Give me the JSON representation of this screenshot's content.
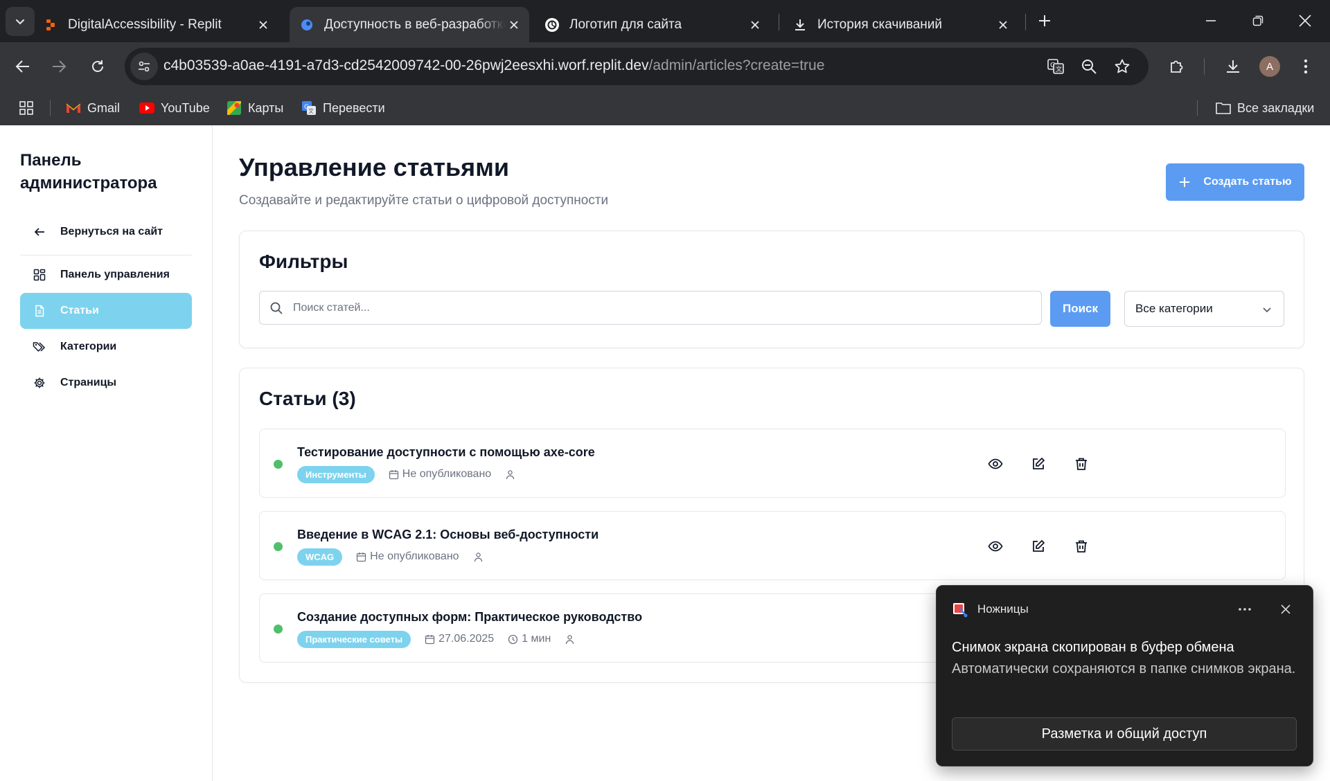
{
  "browser": {
    "tabs": [
      {
        "title": "DigitalAccessibility - Replit",
        "icon": "replit-icon",
        "active": false
      },
      {
        "title": "Доступность в веб-разработке",
        "icon": "replit-favicon-icon",
        "active": true
      },
      {
        "title": "Логотип для сайта",
        "icon": "chatgpt-icon",
        "active": false
      },
      {
        "title": "История скачиваний",
        "icon": "download-icon",
        "active": false
      }
    ],
    "url_host": "c4b03539-a0ae-4191-a7d3-cd2542009742-00-26pwj2eesxhi.worf.replit.dev",
    "url_path": "/admin/articles?create=true",
    "profile_initial": "A",
    "bookmarks": [
      {
        "label": "Gmail",
        "icon": "gmail-icon"
      },
      {
        "label": "YouTube",
        "icon": "youtube-icon"
      },
      {
        "label": "Карты",
        "icon": "maps-icon"
      },
      {
        "label": "Перевести",
        "icon": "translate-icon"
      }
    ],
    "all_bookmarks": "Все закладки"
  },
  "sidebar": {
    "title": "Панель администратора",
    "back": "Вернуться на сайт",
    "items": [
      {
        "label": "Панель управления",
        "icon": "dashboard-icon",
        "active": false
      },
      {
        "label": "Статьи",
        "icon": "document-icon",
        "active": true
      },
      {
        "label": "Категории",
        "icon": "tags-icon",
        "active": false
      },
      {
        "label": "Страницы",
        "icon": "gear-icon",
        "active": false
      }
    ]
  },
  "main": {
    "title": "Управление статьями",
    "subtitle": "Создавайте и редактируйте статьи о цифровой доступности",
    "create_button": "Создать статью",
    "filters": {
      "title": "Фильтры",
      "search_placeholder": "Поиск статей...",
      "search_button": "Поиск",
      "category_select": "Все категории"
    },
    "articles": {
      "title": "Статьи (3)",
      "items": [
        {
          "title": "Тестирование доступности с помощью axe-core",
          "category": "Инструменты",
          "date": "Не опубликовано",
          "read_time": "",
          "status_color": "#4fbf6b"
        },
        {
          "title": "Введение в WCAG 2.1: Основы веб-доступности",
          "category": "WCAG",
          "date": "Не опубликовано",
          "read_time": "",
          "status_color": "#4fbf6b"
        },
        {
          "title": "Создание доступных форм: Практическое руководство",
          "category": "Практические советы",
          "date": "27.06.2025",
          "read_time": "1 мин",
          "status_color": "#4fbf6b"
        }
      ]
    }
  },
  "toast": {
    "app_name": "Ножницы",
    "title": "Снимок экрана скопирован в буфер обмена",
    "body": "Автоматически сохраняются в папке снимков экрана.",
    "button": "Разметка и общий доступ"
  },
  "colors": {
    "accent": "#5b9cf2",
    "sidebar_active": "#7dd3ee",
    "badge": "#7dd3ee",
    "status_published": "#4fbf6b"
  }
}
